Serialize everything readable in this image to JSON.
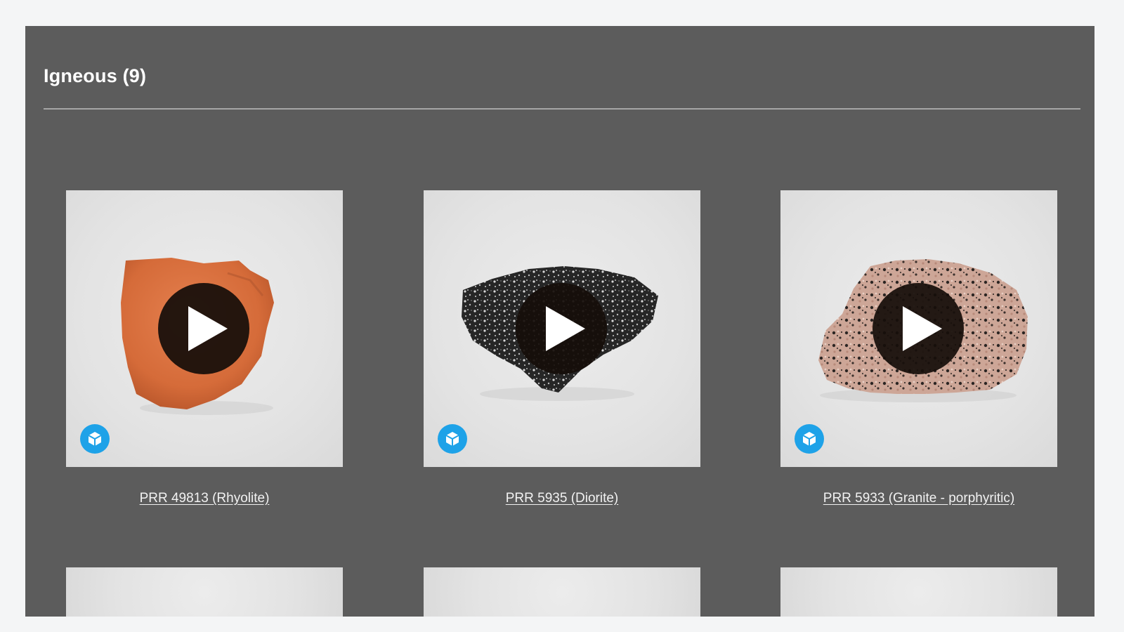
{
  "section": {
    "title": "Igneous (9)"
  },
  "cards": [
    {
      "label": "PRR 49813 (Rhyolite)",
      "rock_color": "#d9703f",
      "icons": [
        "play-icon",
        "3d-model-icon"
      ]
    },
    {
      "label": "PRR 5935 (Diorite)",
      "rock_color": "#2a2a2a",
      "icons": [
        "play-icon",
        "3d-model-icon"
      ]
    },
    {
      "label": "PRR 5933 (Granite - porphyritic)",
      "rock_color": "#c9a79a",
      "icons": [
        "play-icon",
        "3d-model-icon"
      ]
    }
  ],
  "colors": {
    "panel_background": "#5c5c5c",
    "page_background": "#f4f5f6",
    "badge_blue": "#1ea2e8",
    "play_circle": "#160e0a"
  }
}
